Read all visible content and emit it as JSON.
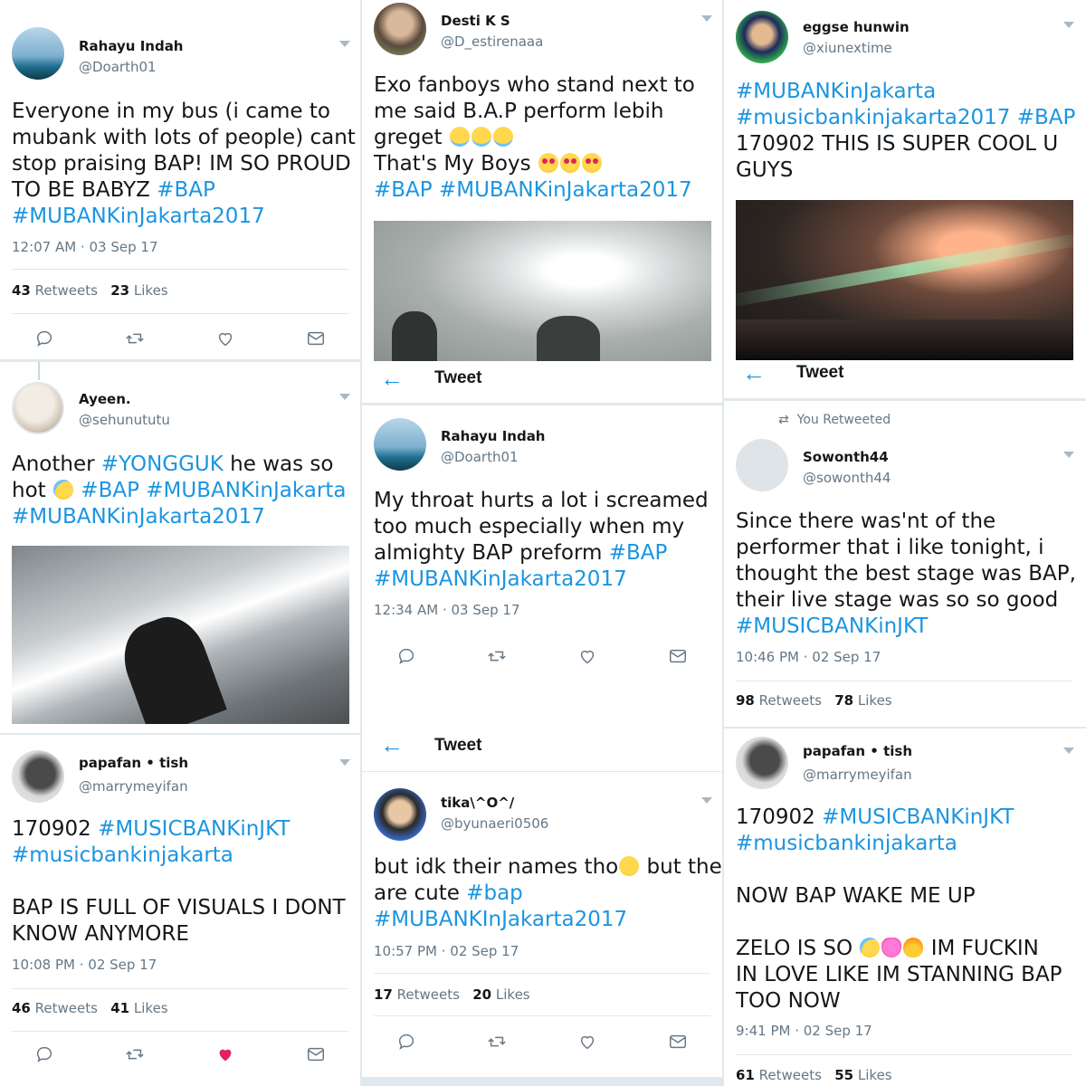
{
  "colors": {
    "link": "#1b95e0",
    "like_active": "#e0245e",
    "muted": "#657786"
  },
  "tweets": {
    "t1": {
      "name": "Rahayu Indah",
      "handle": "@Doarth01",
      "lines": [
        [
          "Everyone in my bus (i came to"
        ],
        [
          "mubank with lots of people) cant"
        ],
        [
          "stop praising BAP! IM SO PROUD"
        ],
        [
          "TO BE BABYZ ",
          "#BAP"
        ],
        [
          "#MUBANKinJakarta2017"
        ]
      ],
      "time": "12:07 AM · 03 Sep 17",
      "retweets": "43",
      "likes": "23",
      "retweets_label": "Retweets",
      "likes_label": "Likes"
    },
    "t2": {
      "name": "Desti K S",
      "handle": "@D_estirenaaa",
      "line1": "Exo fanboys who stand next to",
      "line2": "me said B.A.P perform lebih",
      "line3": "greget ",
      "line4": "That's My Boys ",
      "tag1": "#BAP",
      "tag2": "#MUBANKinJakarta2017"
    },
    "t3": {
      "name": "eggse hunwin",
      "handle": "@xiunextime",
      "tag1": "#MUBANKinJakarta",
      "tag2": "#musicbankinjakarta2017",
      "tag3": "#BAP",
      "line1": "170902 THIS IS SUPER COOL U",
      "line2": "GUYS"
    },
    "t4": {
      "name": "Ayeen.",
      "handle": "@sehunututu",
      "pre": "Another ",
      "tag1": "#YONGGUK",
      "mid": " he was so",
      "hot": "hot ",
      "tag2": "#BAP",
      "tag3": "#MUBANKinJakarta",
      "tag4": "#MUBANKinJakarta2017"
    },
    "t5": {
      "name": "Rahayu Indah",
      "handle": "@Doarth01",
      "line1": "My throat hurts a lot i screamed",
      "line2": "too much especially when my",
      "line3": "almighty BAP preform ",
      "tag1": "#BAP",
      "tag2": "#MUBANKinJakarta2017",
      "time": "12:34 AM · 03 Sep 17"
    },
    "t6": {
      "rt_label": "You Retweeted",
      "name": "Sowonth44",
      "handle": "@sowonth44",
      "line1": "Since there was'nt of the",
      "line2": "performer that i like tonight, i",
      "line3": "thought the best stage was BAP,",
      "line4": "their live stage was so so good",
      "tag1": "#MUSICBANKinJKT",
      "time": "10:46 PM · 02 Sep 17",
      "retweets": "98",
      "likes": "78",
      "retweets_label": "Retweets",
      "likes_label": "Likes"
    },
    "t7": {
      "name": "papafan • tish",
      "handle": "@marrymeyifan",
      "pre": "170902 ",
      "tag1": "#MUSICBANKinJKT",
      "tag2": "#musicbankinjakarta",
      "line1": "BAP IS FULL OF VISUALS I DONT",
      "line2": "KNOW ANYMORE",
      "time": "10:08 PM · 02 Sep 17",
      "retweets": "46",
      "likes": "41",
      "retweets_label": "Retweets",
      "likes_label": "Likes"
    },
    "t8": {
      "name": "tika\\^O^/",
      "handle": "@byunaeri0506",
      "line1a": "but idk their names tho",
      "line1b": " but they",
      "line2": "are cute ",
      "tag1": "#bap",
      "tag2": "#MUBANKInJakarta2017",
      "time": "10:57 PM · 02 Sep 17",
      "retweets": "17",
      "likes": "20",
      "retweets_label": "Retweets",
      "likes_label": "Likes"
    },
    "t9": {
      "name": "papafan • tish",
      "handle": "@marrymeyifan",
      "pre": "170902 ",
      "tag1": "#MUSICBANKinJKT",
      "tag2": "#musicbankinjakarta",
      "line1": "NOW BAP WAKE ME UP",
      "line2a": "ZELO IS SO ",
      "line2b": " IM FUCKIN",
      "line3": "IN LOVE LIKE IM STANNING BAP",
      "line4": "TOO NOW",
      "time": "9:41 PM · 02 Sep 17",
      "retweets": "61",
      "likes": "55",
      "retweets_label": "Retweets",
      "likes_label": "Likes"
    }
  },
  "tweet_header": {
    "title": "Tweet"
  }
}
